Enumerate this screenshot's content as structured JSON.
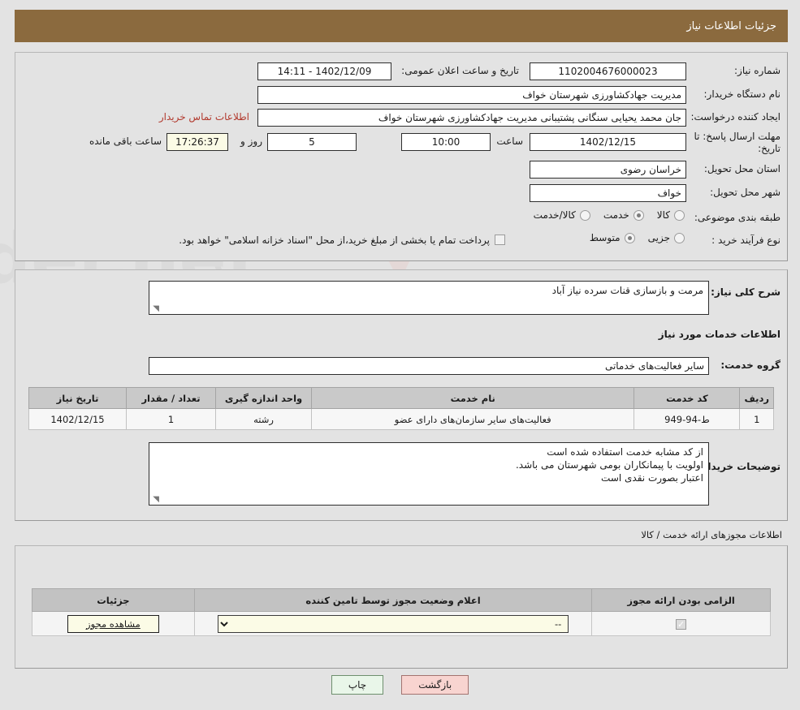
{
  "header": {
    "title": "جزئیات اطلاعات نیاز"
  },
  "watermark": {
    "text": "AriaTender.net"
  },
  "main": {
    "need_number_label": "شماره نیاز:",
    "need_number_value": "1102004676000023",
    "announce_datetime_label": "تاریخ و ساعت اعلان عمومی:",
    "announce_datetime_value": "1402/12/09 - 14:11",
    "buyer_org_label": "نام دستگاه خریدار:",
    "buyer_org_value": "مدیریت جهادکشاورزی شهرستان خواف",
    "requester_label": "ایجاد کننده درخواست:",
    "requester_value": "جان محمد یحیایی سنگانی پشتیبانی مدیریت جهادکشاورزی شهرستان خواف",
    "contact_link": "اطلاعات تماس خریدار",
    "deadline_label": "مهلت ارسال پاسخ: تا تاریخ:",
    "deadline_date": "1402/12/15",
    "hour_label": "ساعت",
    "deadline_time": "10:00",
    "days_remaining": "5",
    "days_label": "روز و",
    "time_remaining": "17:26:37",
    "remaining_suffix": "ساعت باقی مانده",
    "province_label": "استان محل تحویل:",
    "province_value": "خراسان رضوی",
    "city_label": "شهر محل تحویل:",
    "city_value": "خواف",
    "category_label": "طبقه بندی موضوعی:",
    "category_options": [
      {
        "label": "کالا",
        "selected": false
      },
      {
        "label": "خدمت",
        "selected": true
      },
      {
        "label": "کالا/خدمت",
        "selected": false
      }
    ],
    "purchase_type_label": "نوع فرآیند خرید :",
    "purchase_type_options": [
      {
        "label": "جزیی",
        "selected": false
      },
      {
        "label": "متوسط",
        "selected": true
      }
    ],
    "treasury_checkbox_checked": false,
    "treasury_note": "پرداخت تمام یا بخشی از مبلغ خرید،از محل \"اسناد خزانه اسلامی\" خواهد بود."
  },
  "description": {
    "general_label": "شرح کلی نیاز:",
    "general_value": "مرمت و بازسازی قنات سرده نیاز آباد",
    "services_heading": "اطلاعات خدمات مورد نیاز",
    "service_group_label": "گروه خدمت:",
    "service_group_value": "سایر فعالیت‌های خدماتی",
    "table": {
      "headers": [
        "ردیف",
        "کد خدمت",
        "نام خدمت",
        "واحد اندازه گیری",
        "تعداد / مقدار",
        "تاریخ نیاز"
      ],
      "rows": [
        [
          "1",
          "ط-94-949",
          "فعالیت‌های سایر سازمان‌های دارای عضو",
          "رشته",
          "1",
          "1402/12/15"
        ]
      ]
    },
    "buyer_notes_label": "توضیحات خریدار:",
    "buyer_notes_value": "از کد مشابه خدمت استفاده شده است\nاولویت با پیمانکاران بومی شهرستان  می باشد.\nاعتبار بصورت نقدی است"
  },
  "permits": {
    "section_title": "اطلاعات مجوزهای ارائه خدمت / کالا",
    "headers": [
      "الزامی بودن ارائه مجوز",
      "اعلام وضعیت مجوز توسط تامین کننده",
      "جزئیات"
    ],
    "rows": [
      {
        "required_checked": true,
        "status_selected": "--",
        "status_options": [
          "--"
        ],
        "details_button": "مشاهده مجوز"
      }
    ]
  },
  "footer": {
    "print_label": "چاپ",
    "back_label": "بازگشت"
  },
  "colors": {
    "header_bg": "#8b6a3e",
    "link": "#b23a2e",
    "print_bg": "#e9f6e9",
    "back_bg": "#f8d4d0",
    "field_khaki": "#fbfbe6"
  }
}
